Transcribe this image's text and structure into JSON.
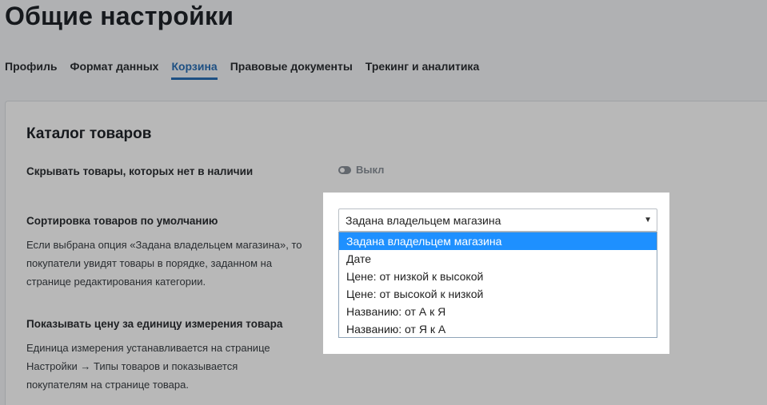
{
  "header": {
    "title": "Общие настройки"
  },
  "tabs": [
    {
      "label": "Профиль"
    },
    {
      "label": "Формат данных"
    },
    {
      "label": "Корзина"
    },
    {
      "label": "Правовые документы"
    },
    {
      "label": "Трекинг и аналитика"
    }
  ],
  "active_tab": "Корзина",
  "catalog": {
    "title": "Каталог товаров",
    "hide_out_of_stock": {
      "label": "Скрывать товары, которых нет в наличии",
      "toggle_label": "Выкл"
    },
    "default_sort": {
      "label": "Сортировка товаров по умолчанию",
      "description_lines": [
        "Если выбрана опция «Задана владельцем магазина», то",
        "покупатели увидят товары в порядке, заданном на",
        "странице редактирования категории."
      ],
      "selected_value": "Задана владельцем магазина",
      "options": [
        "Задана владельцем магазина",
        "Дате",
        "Цене: от низкой к высокой",
        "Цене: от высокой к низкой",
        "Названию: от А к Я",
        "Названию: от Я к А"
      ]
    },
    "unit_price": {
      "label": "Показывать цену за единицу измерения товара",
      "description_lines": [
        "Единица измерения устанавливается на странице",
        "Настройки → Типы товаров и показывается",
        "покупателям на странице товара."
      ]
    }
  }
}
